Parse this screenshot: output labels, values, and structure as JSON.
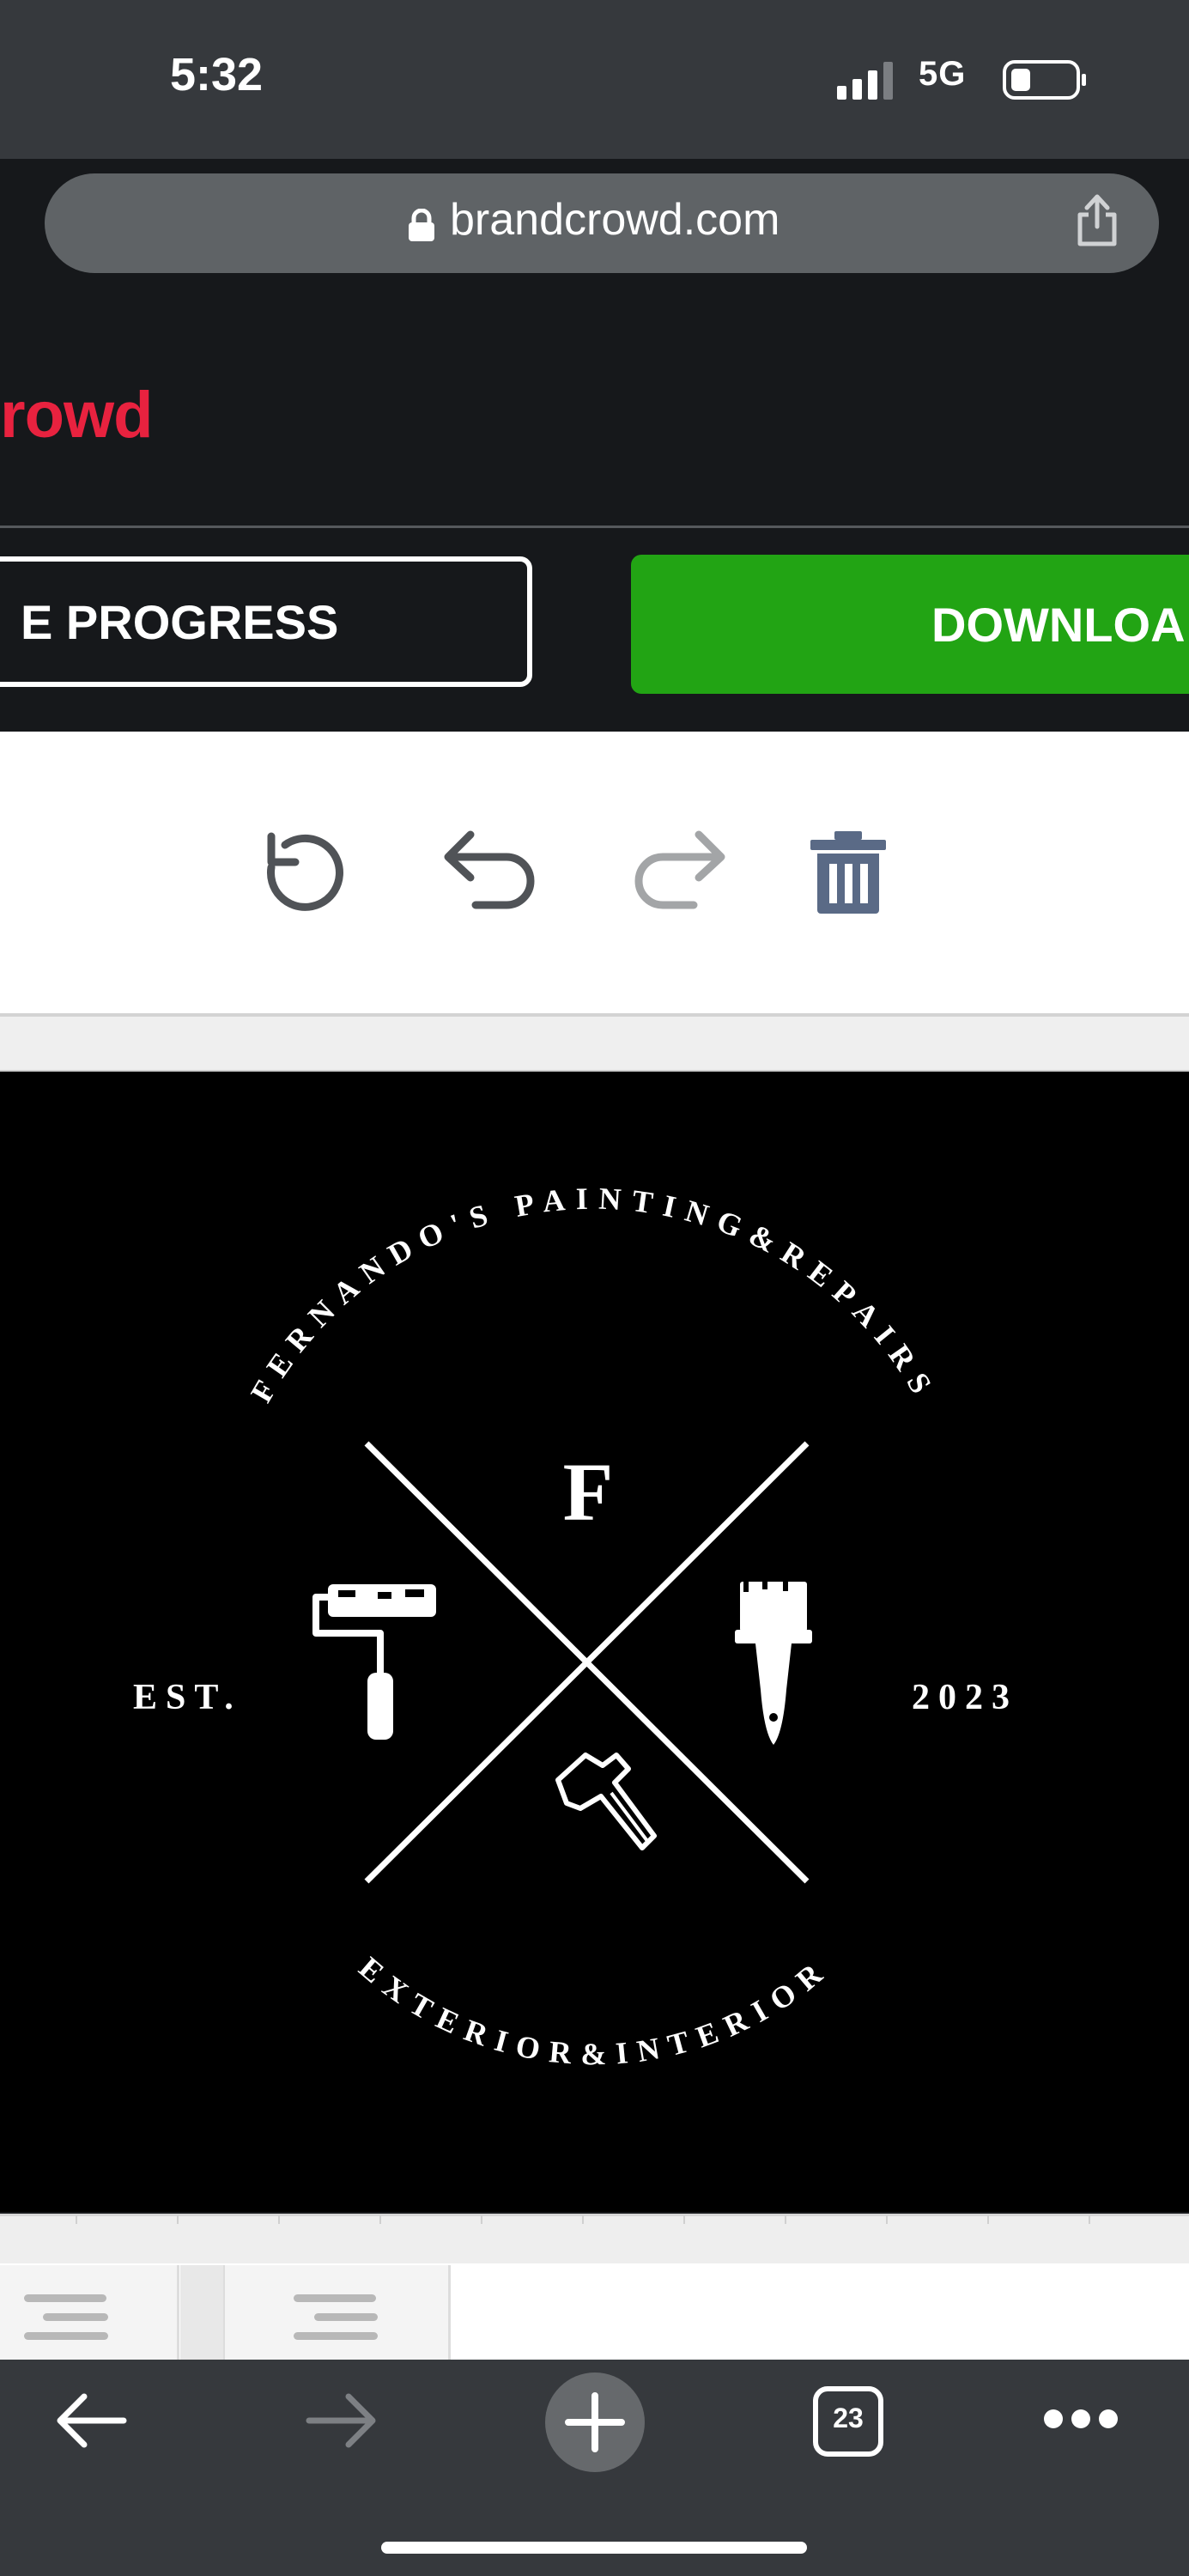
{
  "status_bar": {
    "time": "5:32",
    "network": "5G"
  },
  "browser": {
    "url": "brandcrowd.com"
  },
  "site": {
    "brand_partial": "rowd"
  },
  "actions": {
    "save_label": "E PROGRESS",
    "download_label": "DOWNLOA"
  },
  "logo": {
    "arc_top": "FERNANDO'S PAINTING&REPAIRS",
    "arc_bottom": "EXTERIOR&INTERIOR",
    "monogram": "F",
    "est_label": "EST.",
    "year": "2023"
  },
  "tabs": {
    "count": "23"
  },
  "colors": {
    "brand_red": "#e8223f",
    "download_green": "#22a414",
    "chrome_dark": "#36393d",
    "header_dark": "#16181b",
    "trash_blue": "#5a6a86"
  },
  "icons": [
    "signal-icon",
    "battery-icon",
    "lock-icon",
    "share-icon",
    "reset-icon",
    "undo-icon",
    "redo-icon",
    "trash-icon",
    "back-icon",
    "forward-icon",
    "new-tab-icon",
    "tabs-icon",
    "more-icon"
  ]
}
